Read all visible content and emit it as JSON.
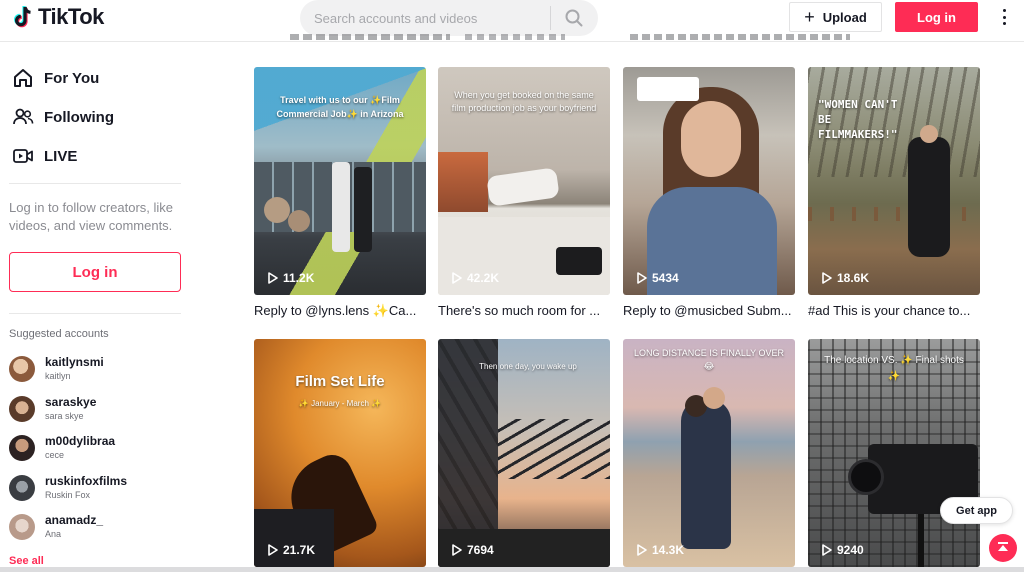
{
  "header": {
    "logo_text": "TikTok",
    "search_placeholder": "Search accounts and videos",
    "upload_label": "Upload",
    "login_label": "Log in"
  },
  "sidebar": {
    "nav": [
      {
        "label": "For You",
        "icon": "home-icon"
      },
      {
        "label": "Following",
        "icon": "following-icon"
      },
      {
        "label": "LIVE",
        "icon": "live-icon"
      }
    ],
    "login_prompt": "Log in to follow creators, like videos, and view comments.",
    "login_label": "Log in",
    "suggested_title": "Suggested accounts",
    "accounts": [
      {
        "handle": "kaitlynsmi",
        "name": "kaitlyn"
      },
      {
        "handle": "saraskye",
        "name": "sara skye"
      },
      {
        "handle": "m00dylibraa",
        "name": "cece"
      },
      {
        "handle": "ruskinfoxfilms",
        "name": "Ruskin Fox"
      },
      {
        "handle": "anamadz_",
        "name": "Ana"
      }
    ],
    "see_all": "See all"
  },
  "feed": {
    "videos": [
      {
        "views": "11.2K",
        "caption": "Reply to @lyns.lens ✨Ca...",
        "overlay": "Travel with us to our ✨Film Commercial Job✨ in Arizona"
      },
      {
        "views": "42.2K",
        "caption": "There's so much room for ...",
        "overlay": "When you get booked on the same film production job as your boyfriend"
      },
      {
        "views": "5434",
        "caption": "Reply to @musicbed Subm...",
        "overlay": ""
      },
      {
        "views": "18.6K",
        "caption": "#ad This is your chance to...",
        "overlay": "\"WOMEN CAN'T BE FILMMAKERS!\""
      },
      {
        "views": "21.7K",
        "caption": "",
        "overlay": "Film Set Life",
        "overlay_sub": "✨ January - March ✨"
      },
      {
        "views": "7694",
        "caption": "",
        "overlay": "Then one day, you wake up"
      },
      {
        "views": "14.3K",
        "caption": "",
        "overlay": "LONG DISTANCE IS FINALLY OVER 😂"
      },
      {
        "views": "9240",
        "caption": "",
        "overlay": "The location VS. ✨ Final shots ✨"
      }
    ]
  },
  "floating": {
    "get_app": "Get app"
  },
  "colors": {
    "brand": "#fe2c55",
    "text": "#161823",
    "muted": "#8a8b91"
  }
}
